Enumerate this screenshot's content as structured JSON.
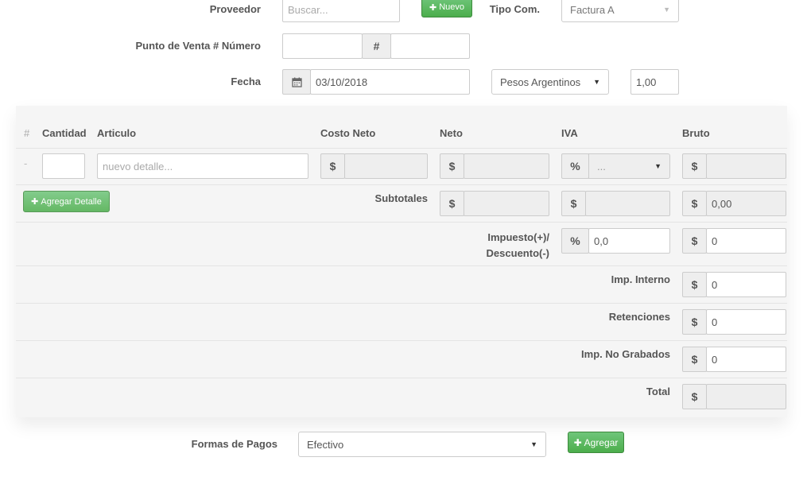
{
  "header": {
    "proveedor_label": "Proveedor",
    "proveedor_placeholder": "Buscar...",
    "nuevo_button": "Nuevo",
    "tipo_com_label": "Tipo Com.",
    "tipo_com_value": "Factura A",
    "punto_venta_label": "Punto de Venta # Número",
    "hash_symbol": "#",
    "fecha_label": "Fecha",
    "fecha_value": "03/10/2018",
    "moneda_value": "Pesos Argentinos",
    "cotizacion_value": "1,00"
  },
  "table": {
    "columns": {
      "num": "#",
      "cantidad": "Cantidad",
      "articulo": "Articulo",
      "costo_neto": "Costo Neto",
      "neto": "Neto",
      "iva": "IVA",
      "bruto": "Bruto"
    },
    "row": {
      "index": "-",
      "articulo_placeholder": "nuevo detalle...",
      "iva_value": "..."
    },
    "agregar_detalle_button": "Agregar Detalle",
    "currency_symbol": "$",
    "percent_symbol": "%"
  },
  "totals": {
    "subtotales_label": "Subtotales",
    "subtotal_bruto": "0,00",
    "impuesto_label_1": "Impuesto(+)/",
    "impuesto_label_2": "Descuento(-)",
    "impuesto_percent": "0,0",
    "impuesto_value": "0",
    "imp_interno_label": "Imp. Interno",
    "imp_interno_value": "0",
    "retenciones_label": "Retenciones",
    "retenciones_value": "0",
    "imp_no_grabados_label": "Imp. No Grabados",
    "imp_no_grabados_value": "0",
    "total_label": "Total",
    "total_value": ""
  },
  "pagos": {
    "label": "Formas de Pagos",
    "selected": "Efectivo",
    "agregar_button": "Agregar"
  }
}
